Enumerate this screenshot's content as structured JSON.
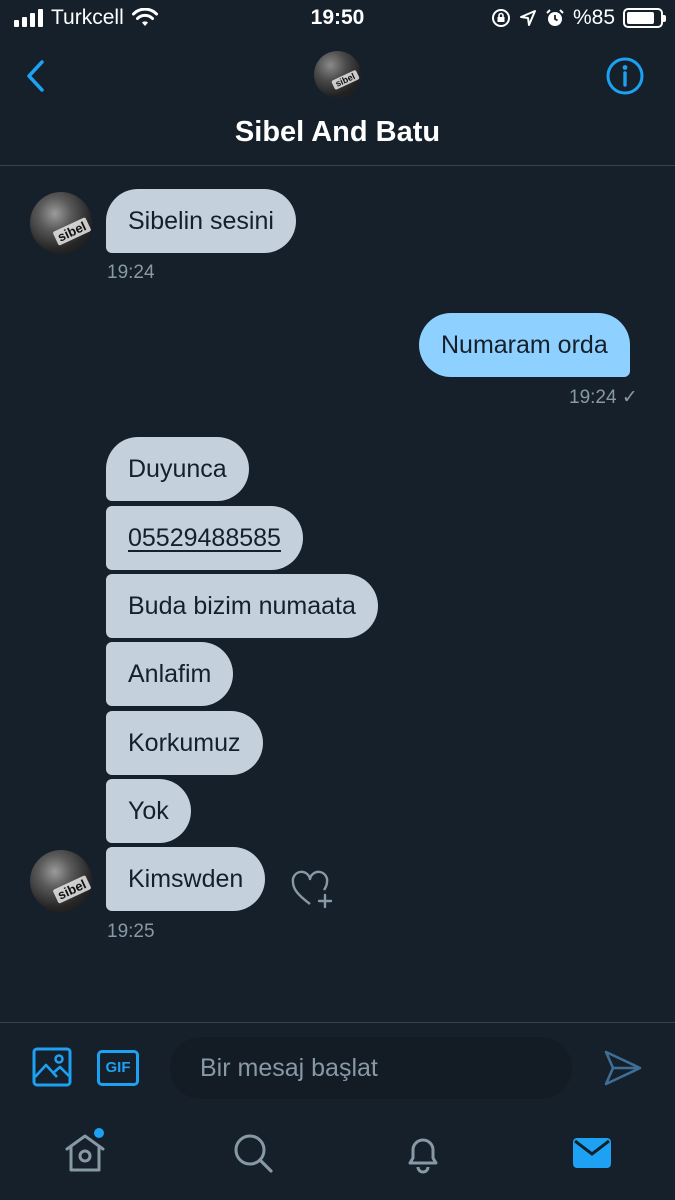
{
  "status_bar": {
    "carrier": "Turkcell",
    "time": "19:50",
    "battery": "%85",
    "battery_level": 0.85
  },
  "header": {
    "title": "Sibel And Batu",
    "avatar_label": "sibel"
  },
  "messages": [
    {
      "direction": "in",
      "text": "Sibelin sesini",
      "time": "19:24"
    },
    {
      "direction": "out",
      "text": "Numaram orda",
      "time": "19:24 ✓"
    },
    {
      "direction": "in",
      "text": "Duyunca"
    },
    {
      "direction": "in",
      "text": "05529488585"
    },
    {
      "direction": "in",
      "text": "Buda bizim numaata"
    },
    {
      "direction": "in",
      "text": "Anlafim"
    },
    {
      "direction": "in",
      "text": "Korkumuz"
    },
    {
      "direction": "in",
      "text": "Yok"
    },
    {
      "direction": "in",
      "text": "Kimswden",
      "time": "19:25"
    }
  ],
  "composer": {
    "gif_label": "GIF",
    "placeholder": "Bir mesaj başlat"
  },
  "colors": {
    "background": "#15202b",
    "accent": "#1da1f2",
    "incoming_bubble": "#c4d0db",
    "outgoing_bubble": "#8ed0ff"
  },
  "icons": [
    "back-icon",
    "info-icon",
    "like-add-icon",
    "image-icon",
    "gif-icon",
    "send-icon",
    "home-icon",
    "search-icon",
    "bell-icon",
    "mail-icon"
  ]
}
